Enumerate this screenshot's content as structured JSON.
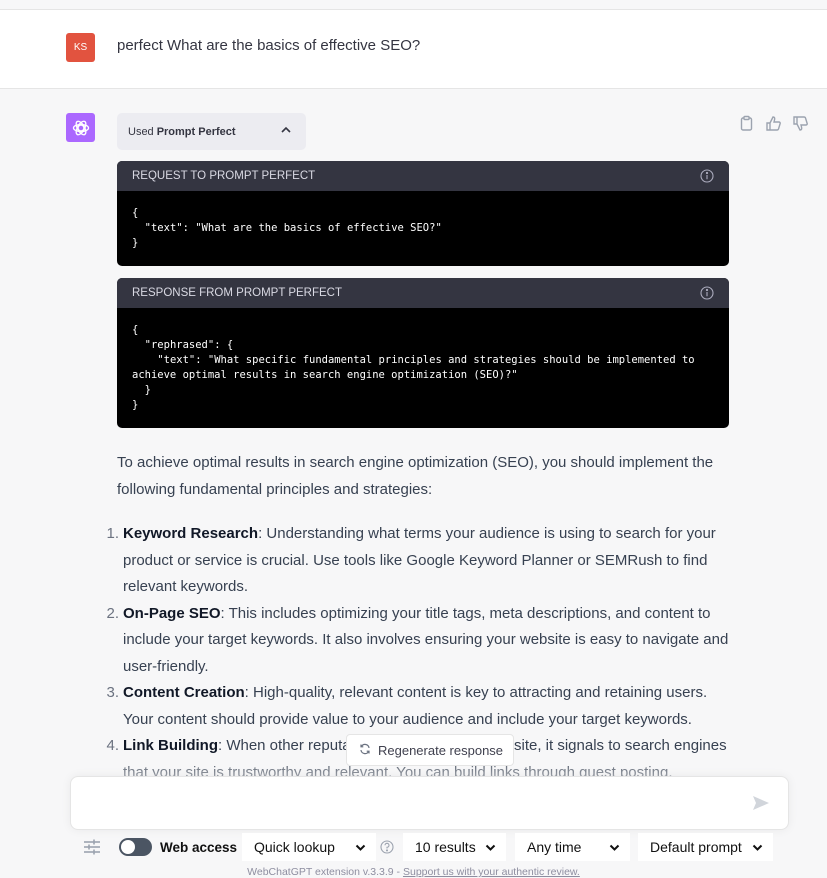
{
  "user_message": {
    "avatar_initials": "KS",
    "avatar_color": "#e2533f",
    "text": "perfect What are the basics of effective SEO?"
  },
  "assistant": {
    "avatar_color": "#ab68ff",
    "plugin_pill": {
      "prefix": "Used",
      "plugin_name": "Prompt Perfect",
      "icon": "chevron-up-icon"
    },
    "actions": [
      "copy-icon",
      "thumbs-up-icon",
      "thumbs-down-icon"
    ],
    "request_box": {
      "title": "REQUEST TO PROMPT PERFECT",
      "code": "{\n  \"text\": \"What are the basics of effective SEO?\"\n}"
    },
    "response_box": {
      "title": "RESPONSE FROM PROMPT PERFECT",
      "code": "{\n  \"rephrased\": {\n    \"text\": \"What specific fundamental principles and strategies should be implemented to achieve optimal results in search engine optimization (SEO)?\"\n  }\n}"
    },
    "intro": "To achieve optimal results in search engine optimization (SEO), you should implement the following fundamental principles and strategies:",
    "list": [
      {
        "num": "1.",
        "title": "Keyword Research",
        "text": ": Understanding what terms your audience is using to search for your product or service is crucial. Use tools like Google Keyword Planner or SEMRush to find relevant keywords."
      },
      {
        "num": "2.",
        "title": "On-Page SEO",
        "text": ": This includes optimizing your title tags, meta descriptions, and content to include your target keywords. It also involves ensuring your website is easy to navigate and user-friendly."
      },
      {
        "num": "3.",
        "title": "Content Creation",
        "text": ": High-quality, relevant content is key to attracting and retaining users. Your content should provide value to your audience and include your target keywords."
      },
      {
        "num": "4.",
        "title": "Link Building",
        "text": ": When other reputable websites link to your site, it signals to search engines that your site is trustworthy and relevant. You can build links through guest posting,"
      }
    ]
  },
  "regenerate_button": {
    "label": "Regenerate response",
    "icon": "refresh-icon"
  },
  "composer": {
    "value": "",
    "placeholder": "",
    "send_icon": "send-icon"
  },
  "webchatgpt_toolbar": {
    "settings_icon": "sliders-icon",
    "web_access_label": "Web access",
    "web_access_on": false,
    "mode": "Quick lookup",
    "help_icon": "question-circle-icon",
    "results": "10 results",
    "time": "Any time",
    "prompt": "Default prompt"
  },
  "footer": {
    "text": "WebChatGPT extension v.3.3.9 - ",
    "link": "Support us with your authentic review."
  }
}
